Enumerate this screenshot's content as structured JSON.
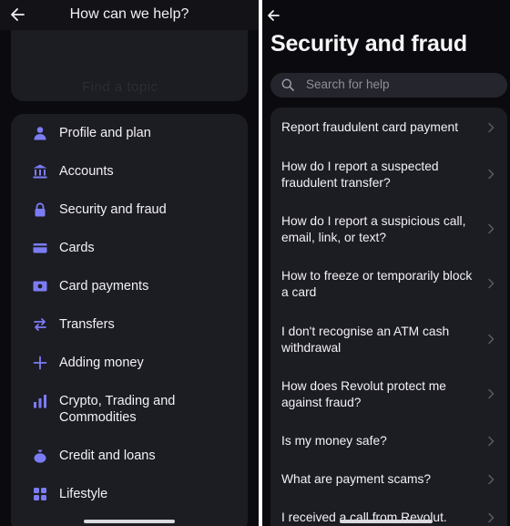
{
  "left": {
    "title": "How can we help?",
    "ghost_text": "Find a topic",
    "menu": [
      {
        "icon": "person-icon",
        "label": "Profile and plan"
      },
      {
        "icon": "bank-icon",
        "label": "Accounts"
      },
      {
        "icon": "lock-icon",
        "label": "Security and fraud"
      },
      {
        "icon": "card-icon",
        "label": "Cards"
      },
      {
        "icon": "card-payment-icon",
        "label": "Card payments"
      },
      {
        "icon": "transfer-arrows-icon",
        "label": "Transfers"
      },
      {
        "icon": "plus-icon",
        "label": "Adding money"
      },
      {
        "icon": "chart-icon",
        "label": "Crypto, Trading and Commodities"
      },
      {
        "icon": "money-bag-icon",
        "label": "Credit and loans"
      },
      {
        "icon": "grid-icon",
        "label": "Lifestyle"
      }
    ]
  },
  "right": {
    "heading": "Security and fraud",
    "search_placeholder": "Search for help",
    "questions": [
      "Report fraudulent card payment",
      "How do I report a suspected fraudulent transfer?",
      "How do I report a suspicious call, email,  link, or text?",
      "How to freeze or temporarily block a card",
      "I don't recognise an ATM cash withdrawal",
      "How does Revolut protect me against fraud?",
      "Is my money safe?",
      "What are payment scams?",
      "I received a call from Revolut."
    ]
  },
  "colors": {
    "background": "#0b0b0f",
    "card": "#1c1c23",
    "accent": "#7b7cf4",
    "text": "#f2f2f5"
  }
}
